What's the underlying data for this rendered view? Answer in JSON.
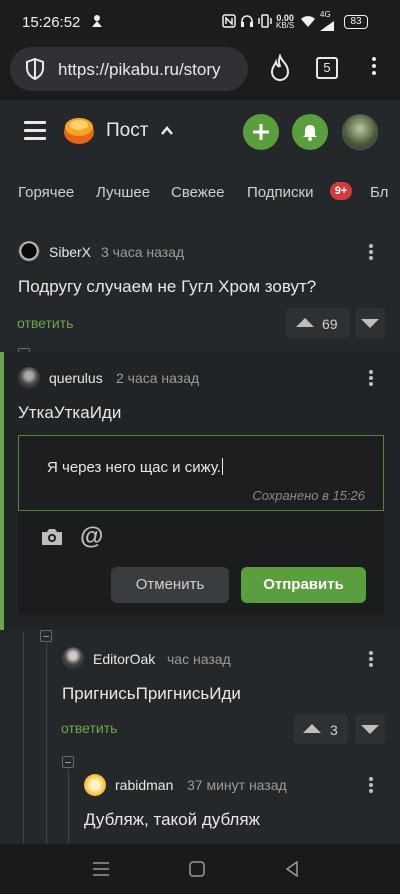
{
  "status_bar": {
    "time": "15:26:52",
    "net_speed_value": "0.00",
    "net_speed_unit": "KB/S",
    "network_type": "4G",
    "battery": "83"
  },
  "browser": {
    "url": "https://pikabu.ru/story",
    "tabs_count": "5"
  },
  "header": {
    "title": "Пост",
    "chevron": "^"
  },
  "nav": {
    "tabs": [
      "Горячее",
      "Лучшее",
      "Свежее",
      "Подписки",
      "Бл"
    ],
    "subscriptions_badge": "9+"
  },
  "comments": [
    {
      "author": "SiberX",
      "time": "3 часа назад",
      "text": "Подругу случаем не Гугл Хром зовут?",
      "reply_label": "ответить",
      "rating": "69"
    },
    {
      "author": "querulus",
      "time": "2 часа назад",
      "text": "УткаУткаИди"
    },
    {
      "author": "EditorOak",
      "time": "час назад",
      "text": "ПригнисьПригнисьИди",
      "reply_label": "ответить",
      "rating": "3"
    },
    {
      "author": "rabidman",
      "time": "37 минут назад",
      "text": "Дубляж, такой дубляж"
    }
  ],
  "reply_form": {
    "value": "Я через него щас и сижу.",
    "saved_note": "Сохранено в 15:26",
    "mention_symbol": "@",
    "cancel_label": "Отменить",
    "send_label": "Отправить"
  },
  "colors": {
    "accent_green": "#5a9e3e",
    "reply_green": "#6aa84f",
    "badge_red": "#d33a3a",
    "background": "#25282b"
  },
  "icons": [
    "shield-icon",
    "fire-icon",
    "hamburger-icon",
    "pikabu-logo",
    "plus-icon",
    "bell-icon",
    "camera-icon",
    "at-icon",
    "chevron-up-icon"
  ]
}
